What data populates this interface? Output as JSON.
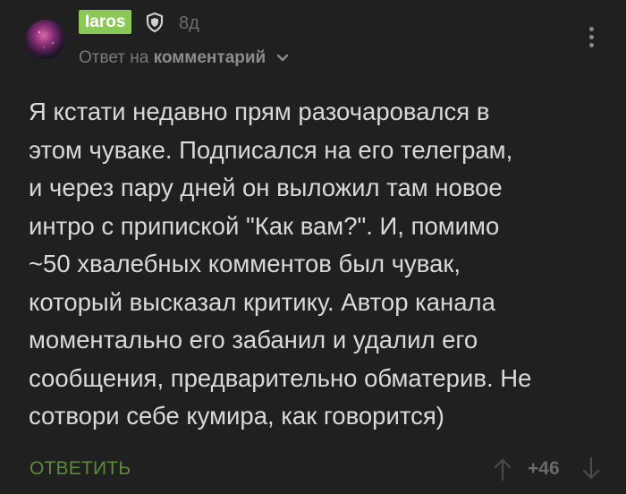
{
  "author": {
    "username": "Iaros",
    "badge_color": "#8ac858",
    "time": "8д",
    "avatar_icon": "avatar-planet"
  },
  "reply_info": {
    "prefix": "Ответ на",
    "target": "комментарий"
  },
  "comment": {
    "lines": [
      "Я кстати недавно прям разочаровался в",
      "этом чуваке. Подписался на его телеграм,",
      "и через пару дней он выложил там новое",
      "интро с припиской \"Как вам?\". И, помимо",
      "~50 хвалебных комментов был чувак,",
      "который высказал критику. Автор канала",
      "моментально его забанил и удалил его",
      "сообщения, предварительно обматерив. Не",
      "сотвори себе кумира, как говорится)"
    ]
  },
  "actions": {
    "reply_label": "ОТВЕТИТЬ",
    "rating": "+46",
    "reply_color": "#5c8a3c"
  },
  "icons": {
    "badge": "shield-icon",
    "menu": "more-vertical-icon",
    "up": "arrow-up-icon",
    "down": "arrow-down-icon"
  }
}
